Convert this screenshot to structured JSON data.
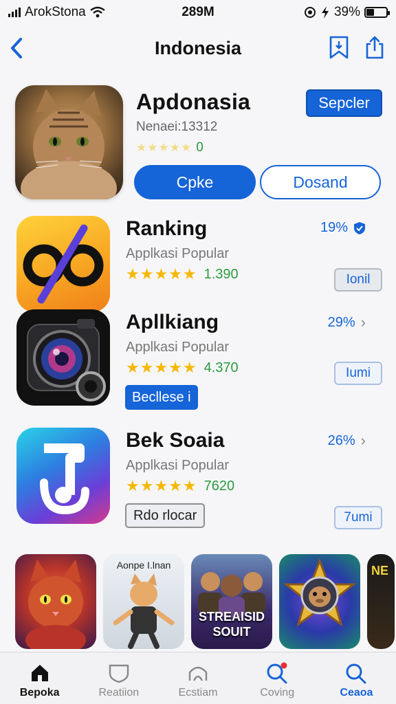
{
  "status": {
    "carrier": "ArokStona",
    "time": "289M",
    "battery": "39%",
    "battery_level": 0.39
  },
  "nav": {
    "title": "Indonesia"
  },
  "featured": {
    "name": "Apdonasia",
    "subtitle": "Nenaei:13312",
    "rating": "0",
    "special_label": "Sepcler",
    "primary_label": "Cpke",
    "secondary_label": "Dosand"
  },
  "rows": [
    {
      "name": "Ranking",
      "subtitle": "Applkasi Popular",
      "rating": "1.390",
      "percent": "19%",
      "tag": "Ionil"
    },
    {
      "name": "Apllkiang",
      "subtitle": "Applkasi Popular",
      "rating": "4.370",
      "percent": "29%",
      "tag": "Iumi",
      "chip": "Becllese i"
    },
    {
      "name": "Bek Soaia",
      "subtitle": "Applkasi Popular",
      "rating": "7620",
      "percent": "26%",
      "tag": "7umi",
      "chip": "Rdo rlocar"
    }
  ],
  "carousel": [
    {
      "title": ""
    },
    {
      "title": "Aonpe I.lnan"
    },
    {
      "title": "STREAISID SOUIT"
    },
    {
      "title": ""
    },
    {
      "title": "NE"
    }
  ],
  "tabs": [
    {
      "label": "Bepoka"
    },
    {
      "label": "Reatiion"
    },
    {
      "label": "Ecstiam"
    },
    {
      "label": "Coving"
    },
    {
      "label": "Ceaoa"
    }
  ],
  "colors": {
    "accent": "#1564d8",
    "rating_green": "#2a9b3c",
    "star": "#f5b800"
  }
}
